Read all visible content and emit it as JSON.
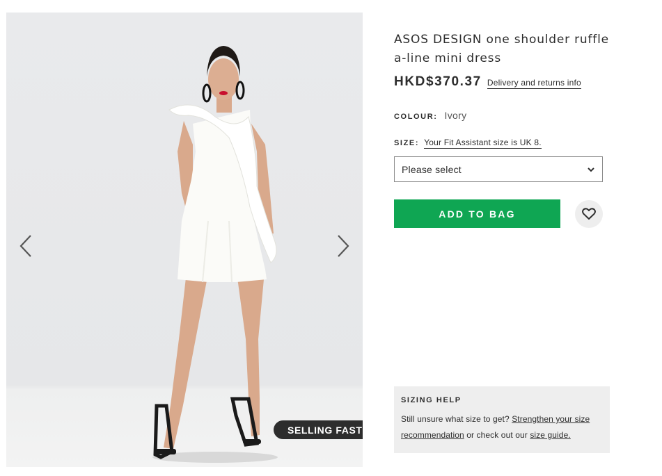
{
  "gallery": {
    "image_alt": "Model wearing ivory one shoulder ruffle a-line mini dress",
    "prev_icon": "chevron-left-icon",
    "next_icon": "chevron-right-icon",
    "badge": "SELLING FAST"
  },
  "product": {
    "title": "ASOS DESIGN one shoulder ruffle a-line mini dress",
    "price": "HKD$370.37",
    "delivery_link": "Delivery and returns info",
    "colour_label": "COLOUR:",
    "colour_value": "Ivory",
    "size_label": "SIZE:",
    "fit_assistant_link": "Your Fit Assistant size is UK 8.",
    "size_select": {
      "selected": "Please select",
      "icon": "chevron-down-icon"
    },
    "add_to_bag": "ADD TO BAG",
    "save_icon": "heart-icon"
  },
  "sizing_help": {
    "title": "SIZING HELP",
    "text_1": "Still unsure what size to get?",
    "link_strengthen": "Strengthen your size recommendation",
    "text_2": "or check out our",
    "link_size_guide": "size guide."
  },
  "colors": {
    "accent_green": "#0fa653",
    "badge_bg": "#2d2d2d",
    "text": "#2d2d2d",
    "panel_bg": "#eeeeee"
  }
}
